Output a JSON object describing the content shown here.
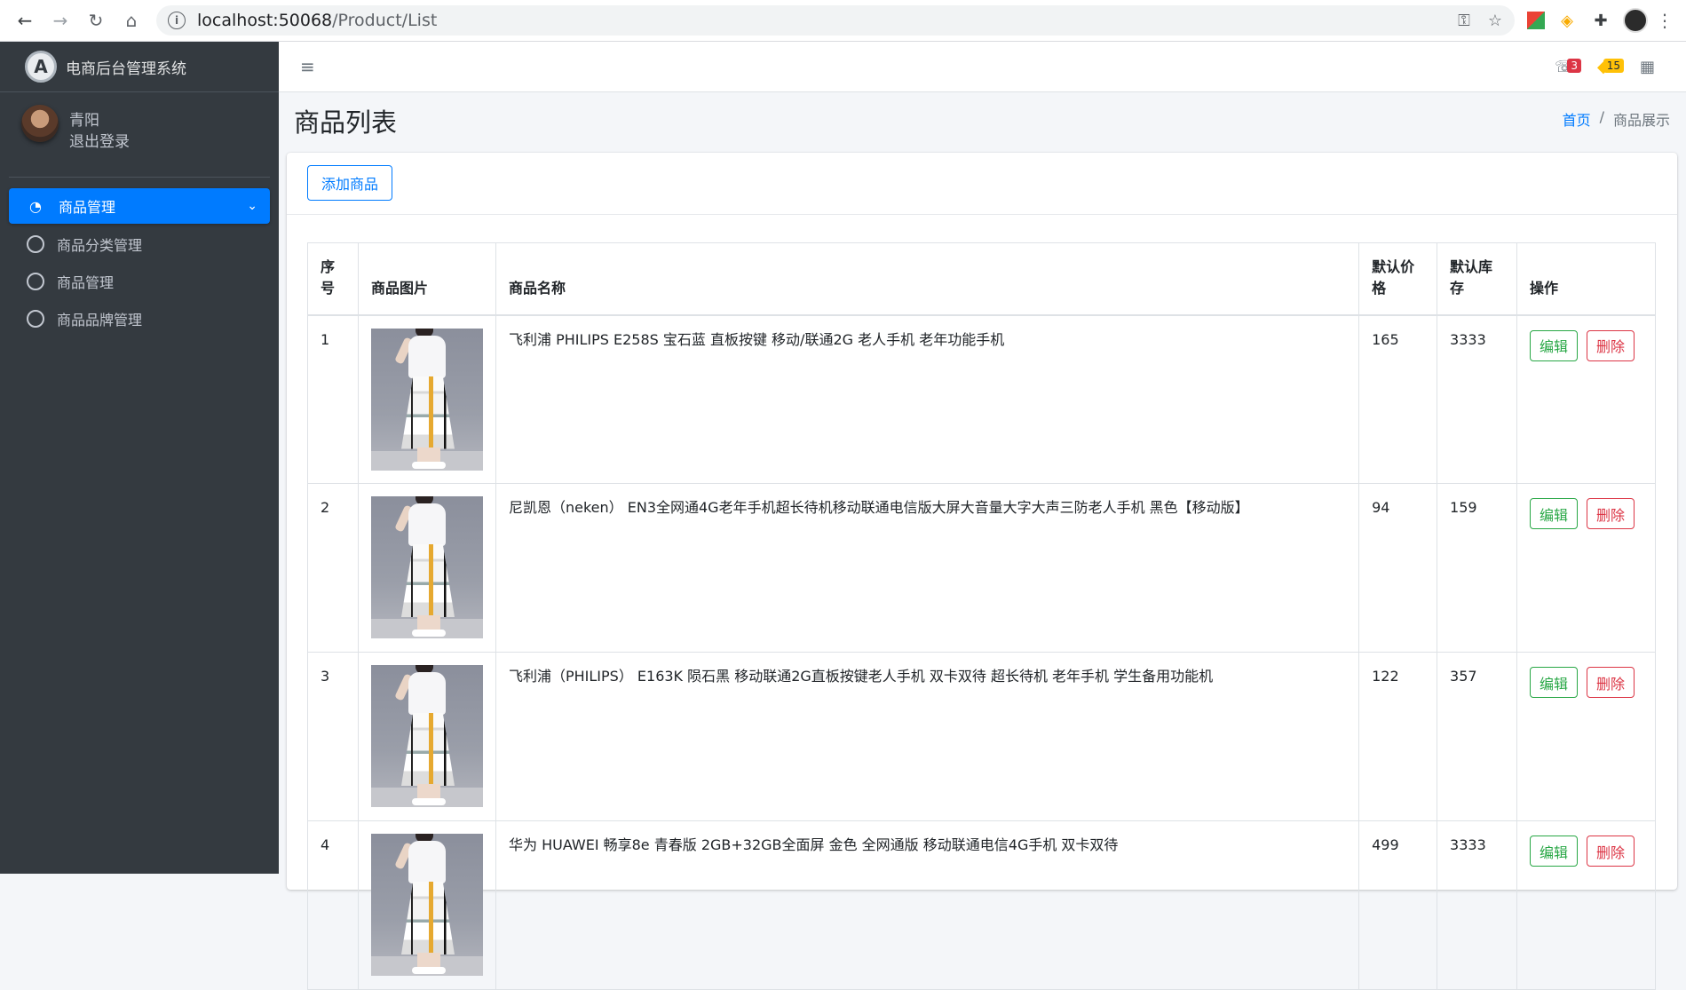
{
  "browser": {
    "url_host": "localhost:50068",
    "url_path": "/Product/List"
  },
  "sidebar": {
    "brand": "电商后台管理系统",
    "brand_logo": "A",
    "user_name": "青阳",
    "logout": "退出登录",
    "menu": {
      "label": "商品管理",
      "items": [
        {
          "label": "商品分类管理"
        },
        {
          "label": "商品管理"
        },
        {
          "label": "商品品牌管理"
        }
      ]
    }
  },
  "topbar": {
    "messages_count": "3",
    "notifications_count": "15"
  },
  "header": {
    "title": "商品列表",
    "breadcrumb_home": "首页",
    "breadcrumb_sep": "/",
    "breadcrumb_current": "商品展示"
  },
  "toolbar": {
    "add_label": "添加商品"
  },
  "table": {
    "columns": [
      "序号",
      "商品图片",
      "商品名称",
      "默认价格",
      "默认库存",
      "操作"
    ],
    "edit_label": "编辑",
    "delete_label": "删除",
    "rows": [
      {
        "id": "1",
        "name": "飞利浦 PHILIPS E258S 宝石蓝 直板按键 移动/联通2G 老人手机 老年功能手机",
        "price": "165",
        "stock": "3333"
      },
      {
        "id": "2",
        "name": "尼凯恩（neken） EN3全网通4G老年手机超长待机移动联通电信版大屏大音量大字大声三防老人手机 黑色【移动版】",
        "price": "94",
        "stock": "159"
      },
      {
        "id": "3",
        "name": "飞利浦（PHILIPS） E163K 陨石黑 移动联通2G直板按键老人手机 双卡双待 超长待机 老年手机 学生备用功能机",
        "price": "122",
        "stock": "357"
      },
      {
        "id": "4",
        "name": "华为 HUAWEI 畅享8e 青春版 2GB+32GB全面屏 金色 全网通版 移动联通电信4G手机 双卡双待",
        "price": "499",
        "stock": "3333"
      }
    ]
  }
}
